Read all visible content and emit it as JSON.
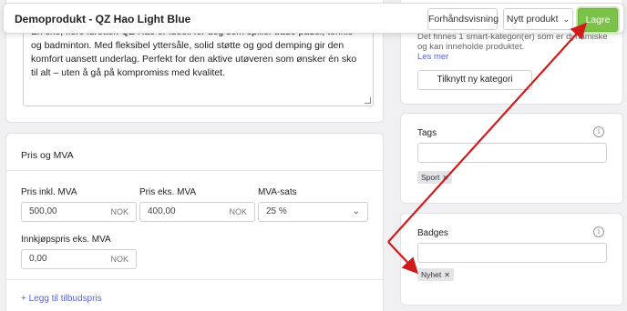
{
  "header": {
    "title": "Demoprodukt - QZ Hao Light Blue",
    "preview_label": "Forhåndsvisning",
    "new_product_label": "Nytt produkt",
    "save_label": "Lagre"
  },
  "description": {
    "text": "Én sko, flere idretter. QZ Hao er ideell for deg som spiller både padel, tennis og badminton. Med fleksibel yttersåle, solid støtte og god demping gir den komfort uansett underlag. Perfekt for den aktive utøveren som ønsker én sko til alt – uten å gå på kompromiss med kvalitet."
  },
  "pricing": {
    "section_title": "Pris og MVA",
    "price_incl_label": "Pris inkl. MVA",
    "price_incl_value": "500,00",
    "price_excl_label": "Pris eks. MVA",
    "price_excl_value": "400,00",
    "vat_label": "MVA-sats",
    "vat_value": "25 %",
    "purchase_label": "Innkjøpspris eks. MVA",
    "purchase_value": "0,00",
    "currency": "NOK",
    "add_offer_label": "+ Legg til tilbudspris"
  },
  "categories": {
    "info_text": "Det finnes 1 smart-kategori(er) som er dynamiske og kan inneholde produktet.",
    "read_more": "Les mer",
    "assign_label": "Tilknytt ny kategori"
  },
  "tags": {
    "title": "Tags",
    "chip": "Sport"
  },
  "badges": {
    "title": "Badges",
    "chip": "Nyhet"
  },
  "colors": {
    "accent_green": "#7cc24a",
    "link": "#5a62d6",
    "arrow": "#d11a1a"
  },
  "icons": {
    "info": "info-icon",
    "close": "close-icon",
    "chevron": "chevron-down-icon"
  }
}
